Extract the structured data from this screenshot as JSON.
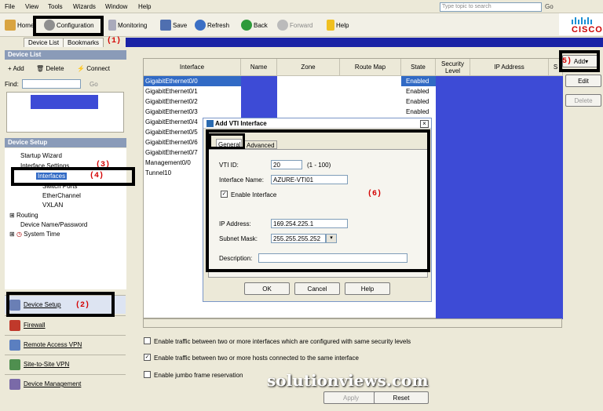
{
  "menu": [
    "File",
    "View",
    "Tools",
    "Wizards",
    "Window",
    "Help"
  ],
  "search": {
    "placeholder": "Type topic to search",
    "go": "Go"
  },
  "toolbar": {
    "home": "Home",
    "configuration": "Configuration",
    "monitoring": "Monitoring",
    "save": "Save",
    "refresh": "Refresh",
    "back": "Back",
    "forward": "Forward",
    "help": "Help"
  },
  "brand": "CISCO",
  "tabs": {
    "device_list": "Device List",
    "bookmarks": "Bookmarks"
  },
  "annotations": {
    "a1": "(1)",
    "a2": "(2)",
    "a3": "(3)",
    "a4": "(4)",
    "a5": "5)",
    "a6": "(6)"
  },
  "device_list": {
    "title": "Device List",
    "add": "Add",
    "delete": "Delete",
    "connect": "Connect",
    "find": "Find:",
    "go": "Go"
  },
  "device_setup": {
    "title": "Device Setup",
    "items": [
      "Startup Wizard",
      "Interface Settings",
      "Interfaces",
      "EtherChannel",
      "VXLAN",
      "Routing",
      "Device Name/Password",
      "System Time"
    ],
    "hidden_item": "Switch Ports"
  },
  "nav": [
    "Device Setup",
    "Firewall",
    "Remote Access VPN",
    "Site-to-Site VPN",
    "Device Management"
  ],
  "grid": {
    "headers": [
      "Interface",
      "Name",
      "Zone",
      "Route Map",
      "State",
      "Security Level",
      "IP Address",
      "S"
    ],
    "rows": [
      {
        "iface": "GigabitEthernet0/0",
        "state": "Enabled"
      },
      {
        "iface": "GigabitEthernet0/1",
        "state": "Enabled"
      },
      {
        "iface": "GigabitEthernet0/2",
        "state": "Enabled"
      },
      {
        "iface": "GigabitEthernet0/3",
        "state": "Enabled"
      },
      {
        "iface": "GigabitEthernet0/4",
        "state": ""
      },
      {
        "iface": "GigabitEthernet0/5",
        "state": ""
      },
      {
        "iface": "GigabitEthernet0/6",
        "state": ""
      },
      {
        "iface": "GigabitEthernet0/7",
        "state": ""
      },
      {
        "iface": "Management0/0",
        "state": ""
      },
      {
        "iface": "Tunnel10",
        "state": ""
      }
    ]
  },
  "side_buttons": {
    "add": "Add",
    "edit": "Edit",
    "delete": "Delete"
  },
  "dialog": {
    "title": "Add VTI Interface",
    "tab_general": "General",
    "tab_advanced": "Advanced",
    "vti_id_label": "VTI ID:",
    "vti_id": "20",
    "vti_range": "(1 - 100)",
    "name_label": "Interface Name:",
    "name": "AZURE-VTI01",
    "enable": "Enable Interface",
    "ip_label": "IP Address:",
    "ip": "169.254.225.1",
    "mask_label": "Subnet Mask:",
    "mask": "255.255.255.252",
    "desc_label": "Description:",
    "desc": "",
    "ok": "OK",
    "cancel": "Cancel",
    "help": "Help"
  },
  "options": [
    "Enable traffic between two or more interfaces which are configured with same security levels",
    "Enable traffic between two or more hosts connected to the same interface",
    "Enable jumbo frame reservation"
  ],
  "bottom": {
    "apply": "Apply",
    "reset": "Reset"
  },
  "watermark": "solutionviews.com"
}
